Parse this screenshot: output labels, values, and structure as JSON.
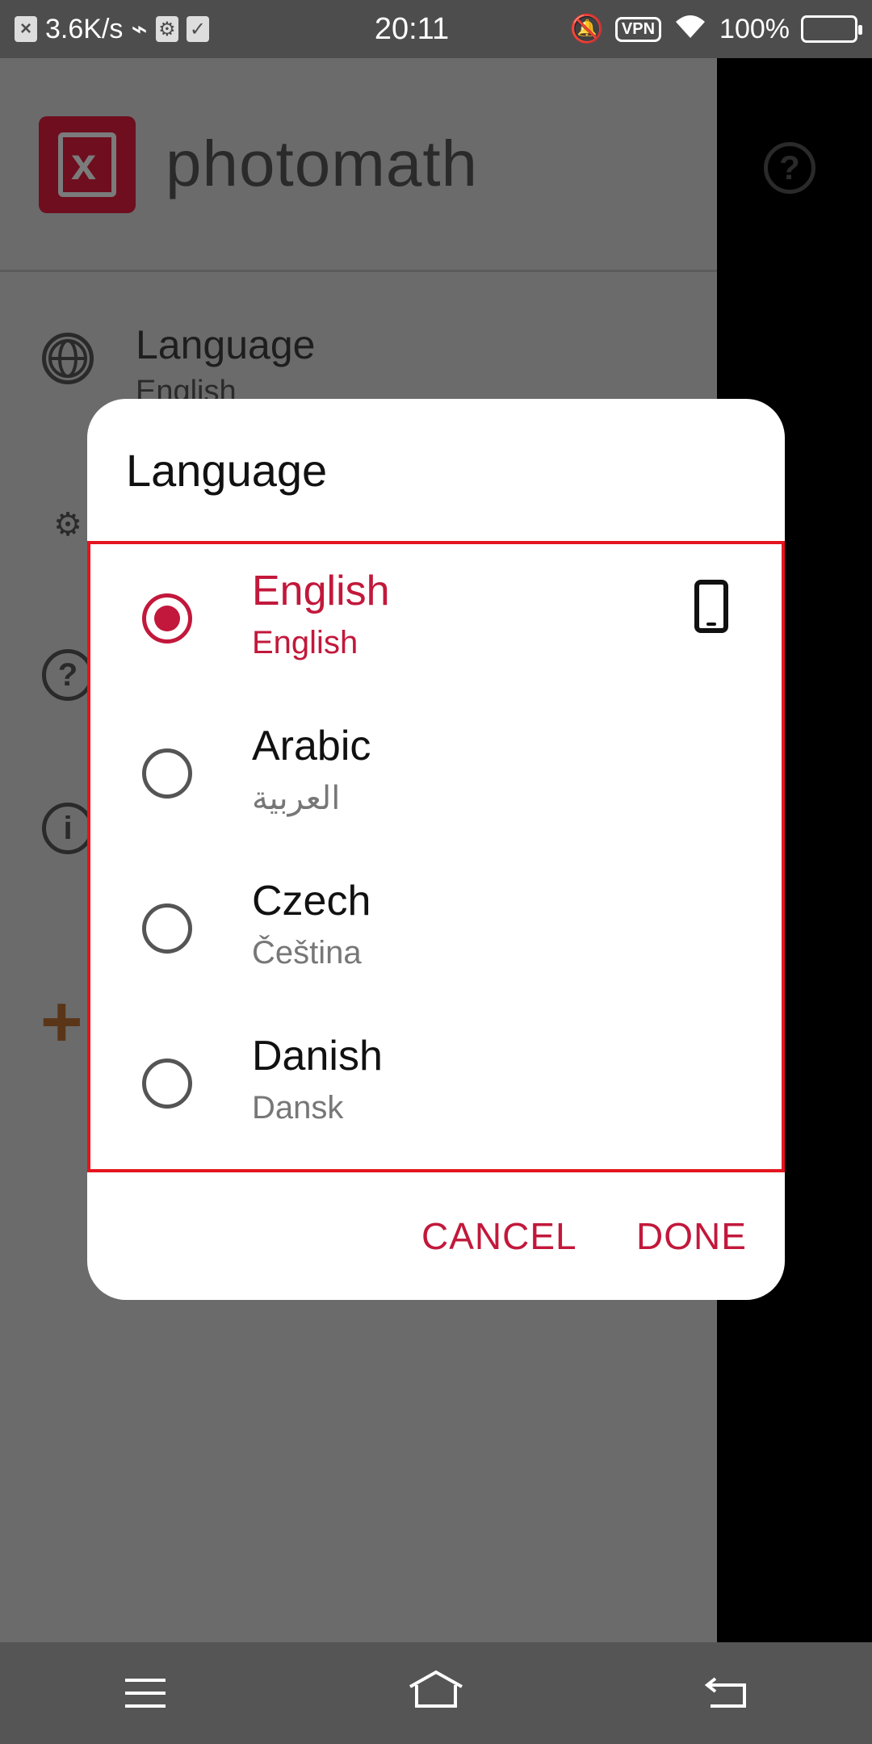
{
  "status_bar": {
    "net_speed": "3.6K/s",
    "time": "20:11",
    "vpn": "VPN",
    "battery": "100%"
  },
  "app": {
    "brand": "photomath",
    "menu": [
      {
        "label": "Language",
        "sub": "English"
      }
    ]
  },
  "dialog": {
    "title": "Language",
    "languages": [
      {
        "name": "English",
        "native": "English"
      },
      {
        "name": "Arabic",
        "native": "العربية"
      },
      {
        "name": "Czech",
        "native": "Čeština"
      },
      {
        "name": "Danish",
        "native": "Dansk"
      }
    ],
    "cancel_label": "CANCEL",
    "done_label": "DONE"
  },
  "colors": {
    "accent": "#c2183b",
    "highlight_border": "#e4141e",
    "logo_bg": "#6e0e1f"
  }
}
